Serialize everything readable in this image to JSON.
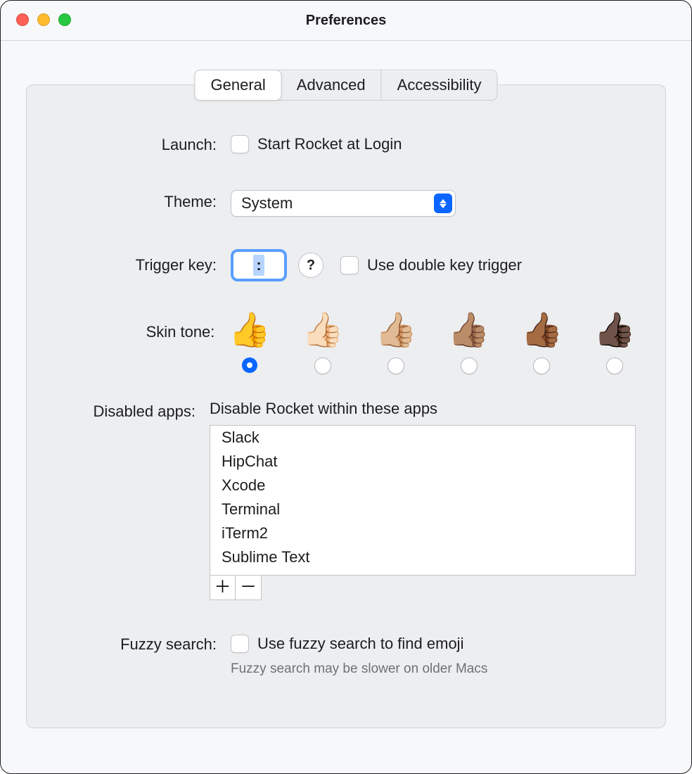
{
  "window": {
    "title": "Preferences"
  },
  "tabs": {
    "general": "General",
    "advanced": "Advanced",
    "accessibility": "Accessibility",
    "active": "general"
  },
  "labels": {
    "launch": "Launch:",
    "theme": "Theme:",
    "trigger_key": "Trigger key:",
    "skin_tone": "Skin tone:",
    "disabled_apps": "Disabled apps:",
    "fuzzy_search": "Fuzzy search:"
  },
  "launch": {
    "checkbox_label": "Start Rocket at Login",
    "checked": false
  },
  "theme": {
    "value": "System"
  },
  "trigger": {
    "key": ":",
    "help_text": "?",
    "double_label": "Use double key trigger",
    "double_checked": false
  },
  "skin_tones": {
    "emojis": [
      "👍",
      "👍🏻",
      "👍🏼",
      "👍🏽",
      "👍🏾",
      "👍🏿"
    ],
    "selected_index": 0
  },
  "disabled_apps": {
    "description": "Disable Rocket within these apps",
    "items": [
      "Slack",
      "HipChat",
      "Xcode",
      "Terminal",
      "iTerm2",
      "Sublime Text"
    ]
  },
  "fuzzy": {
    "checkbox_label": "Use fuzzy search to find emoji",
    "checked": false,
    "hint": "Fuzzy search may be slower on older Macs"
  }
}
